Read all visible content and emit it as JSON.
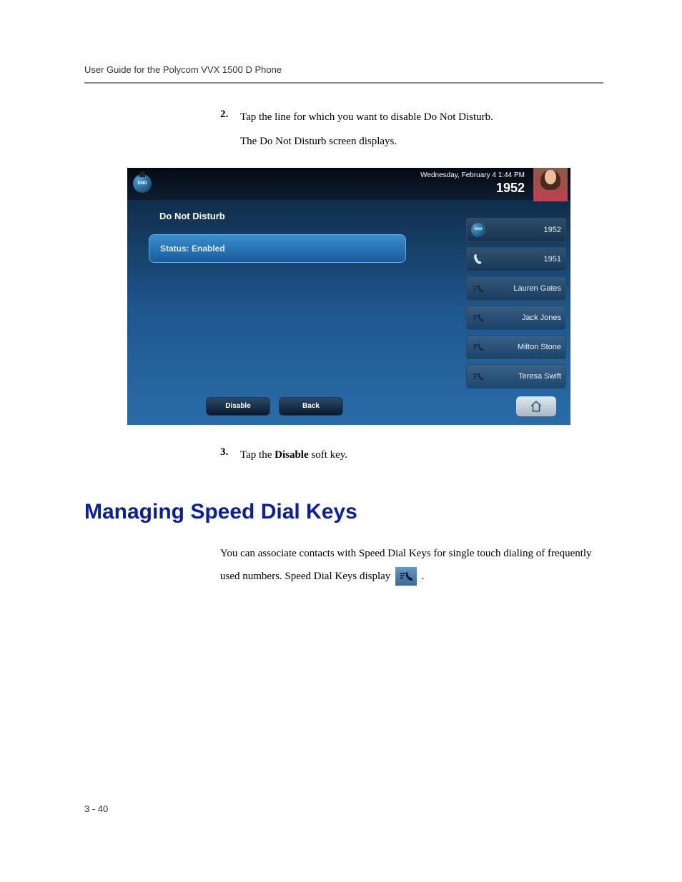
{
  "page": {
    "header": "User Guide for the Polycom VVX 1500 D Phone",
    "number": "3 - 40"
  },
  "steps": {
    "s2": {
      "num": "2.",
      "text": "Tap the line for which you want to disable Do Not Disturb.",
      "sub": "The Do Not Disturb screen displays."
    },
    "s3": {
      "num": "3.",
      "pre": "Tap the ",
      "bold": "Disable",
      "post": " soft key."
    }
  },
  "section": {
    "heading": "Managing Speed Dial Keys",
    "para_a": "You can associate contacts with Speed Dial Keys for single touch dialing of frequently used numbers. Speed Dial Keys display ",
    "para_b": " ."
  },
  "screenshot": {
    "topbar": {
      "dnd_label": "DND",
      "date": "Wednesday, February 4  1:44 PM",
      "ext": "1952"
    },
    "title": "Do Not Disturb",
    "status": "Status: Enabled",
    "lines": [
      {
        "label": "1952",
        "dnd": true
      },
      {
        "label": "1951",
        "dnd": false
      },
      {
        "label": "Lauren Gates",
        "dnd": false,
        "speed": true
      },
      {
        "label": "Jack Jones",
        "dnd": false,
        "speed": true
      },
      {
        "label": "Milton Stone",
        "dnd": false,
        "speed": true
      },
      {
        "label": "Teresa Swift",
        "dnd": false,
        "speed": true
      }
    ],
    "softkeys": {
      "disable": "Disable",
      "back": "Back"
    }
  }
}
